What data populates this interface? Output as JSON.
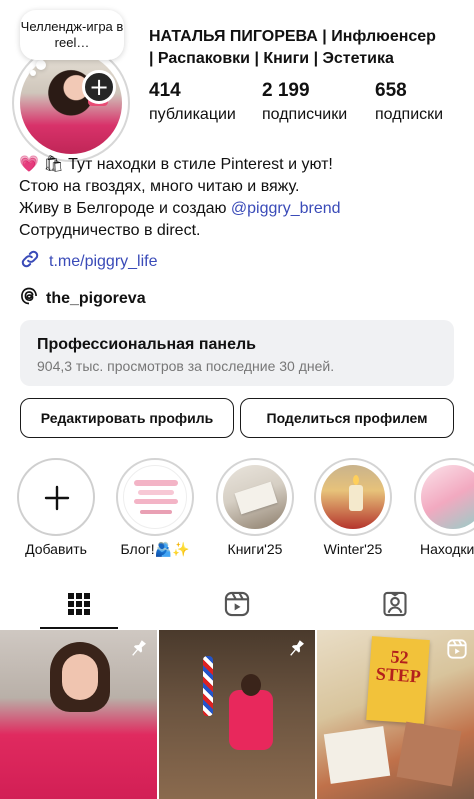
{
  "profile": {
    "note": "Челлендж-игра в reel…",
    "name_line1": "НАТАЛЬЯ ПИГОРЕВА | Инфлюенсер",
    "name_line2": "| Распаковки | Книги | Эстетика",
    "stats": [
      {
        "value": "414",
        "label": "публикации"
      },
      {
        "value": "2 199",
        "label": "подписчики"
      },
      {
        "value": "658",
        "label": "подписки"
      }
    ]
  },
  "bio": {
    "line1": "💗 🛍 Тут находки в стиле Pinterest и уют!",
    "line2": "Стою на гвоздях, много читаю и вяжу.",
    "line3_prefix": "Живу в Белгороде и создаю ",
    "mention": "@piggry_brend",
    "line4": "Сотрудничество в direct.",
    "link": "t.me/piggry_life",
    "threads": "the_pigoreva"
  },
  "pro_panel": {
    "title": "Профессиональная панель",
    "subtitle": "904,3 тыс. просмотров за последние 30 дней."
  },
  "buttons": {
    "edit": "Редактировать профиль",
    "share": "Поделиться профилем"
  },
  "highlights": [
    {
      "label": "Добавить"
    },
    {
      "label": "Блог!🫂✨"
    },
    {
      "label": "Книги'25"
    },
    {
      "label": "Winter'25"
    },
    {
      "label": "Находки"
    }
  ],
  "grid_posts": [
    {
      "text": "52 STEP"
    }
  ],
  "colors": {
    "link": "#3a4bb8",
    "panel_bg": "#f0f1f3",
    "sweater_pink": "#e02a5f"
  },
  "icons": [
    "plus-icon",
    "link-icon",
    "threads-icon",
    "grid-icon",
    "reels-icon",
    "tagged-icon",
    "pin-icon",
    "reel-badge-icon"
  ]
}
